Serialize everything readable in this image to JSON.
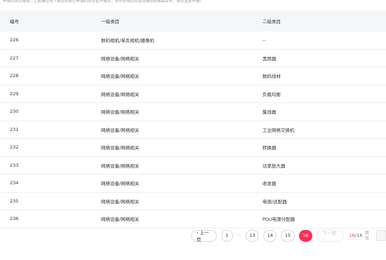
{
  "notice": "申请的类目授权。之前通过线下渠道资质已申请的类目暂不展示，但不影响您的类目授权和商品发布，请您重复申请!",
  "table": {
    "headers": {
      "id": "编号",
      "category1": "一级类目",
      "category2": "二级类目"
    },
    "rows": [
      {
        "id": "226",
        "category1": "数码相机/单反相机/摄像机",
        "category2": "--"
      },
      {
        "id": "227",
        "category1": "网络设备/网络相关",
        "category2": "黑用器"
      },
      {
        "id": "228",
        "category1": "网络设备/网络相关",
        "category2": "数码线材"
      },
      {
        "id": "229",
        "category1": "网络设备/网络相关",
        "category2": "负载均衡"
      },
      {
        "id": "230",
        "category1": "网络设备/网络相关",
        "category2": "集线器"
      },
      {
        "id": "231",
        "category1": "网络设备/网络相关",
        "category2": "工业网络交换机"
      },
      {
        "id": "232",
        "category1": "网络设备/网络相关",
        "category2": "转换器"
      },
      {
        "id": "233",
        "category1": "网络设备/网络相关",
        "category2": "功率放大器"
      },
      {
        "id": "234",
        "category1": "网络设备/网络相关",
        "category2": "收发器"
      },
      {
        "id": "235",
        "category1": "网络设备/网络相关",
        "category2": "电源/适配器"
      },
      {
        "id": "236",
        "category1": "网络设备/网络相关",
        "category2": "PDU电源分配器"
      }
    ]
  },
  "pagination": {
    "prev_label": "‹ 上一页",
    "first_page": "1",
    "ellipsis": "···",
    "pages": [
      "13",
      "14",
      "15"
    ],
    "current_page": "16",
    "next_label": "下一页 ›",
    "current_count": "16",
    "total_count": "/16",
    "jump_label": "跳转"
  }
}
